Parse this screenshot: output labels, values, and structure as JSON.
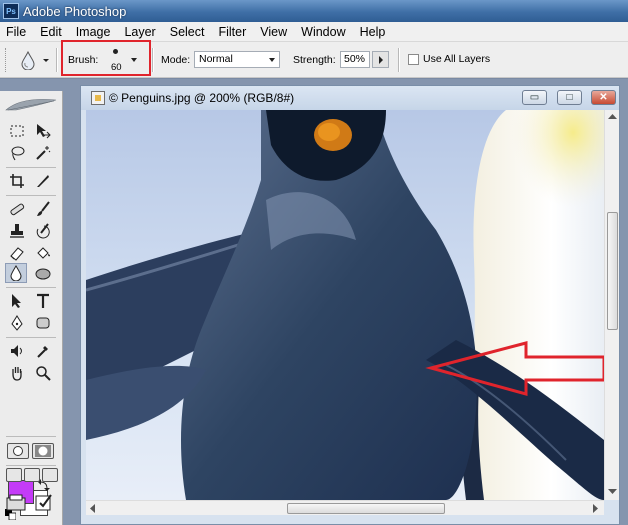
{
  "window": {
    "title": "Adobe Photoshop",
    "app_icon": "Ps"
  },
  "menu": {
    "items": [
      "File",
      "Edit",
      "Image",
      "Layer",
      "Select",
      "Filter",
      "View",
      "Window",
      "Help"
    ]
  },
  "options_bar": {
    "tool_icon": "blur-drop-icon",
    "brush_label": "Brush:",
    "brush_size": "60",
    "mode_label": "Mode:",
    "mode_value": "Normal",
    "strength_label": "Strength:",
    "strength_value": "50%",
    "use_all_layers_label": "Use All Layers",
    "use_all_layers_checked": false,
    "highlight_color": "#e0242c"
  },
  "toolbox": {
    "foreground_color": "#c43bf7",
    "background_color": "#ffffff",
    "active_tool": "blur-tool"
  },
  "document": {
    "title": "© Penguins.jpg @ 200% (RGB/8#)",
    "minimize_glyph": "▭",
    "maximize_glyph": "□",
    "close_glyph": "✕"
  },
  "annotation": {
    "shape": "arrow-left",
    "color": "#e0242c"
  }
}
